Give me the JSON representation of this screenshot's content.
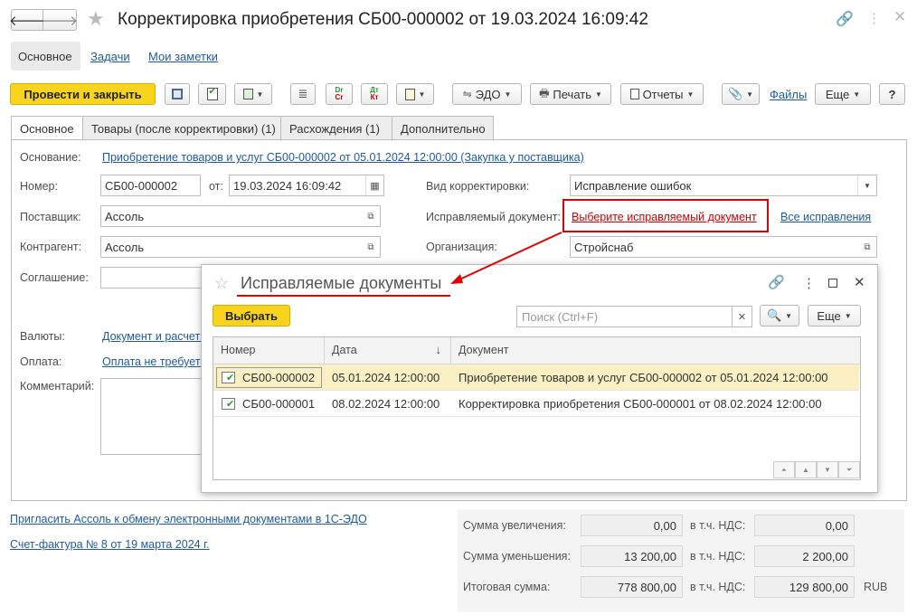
{
  "window": {
    "title": "Корректировка приобретения СБ00-000002 от 19.03.2024 16:09:42"
  },
  "nav": {
    "back": "🡐",
    "forward": "🡒"
  },
  "section_tabs": [
    "Основное",
    "Задачи",
    "Мои заметки"
  ],
  "toolbar": {
    "post_close": "Провести и закрыть",
    "edo": "ЭДО",
    "print": "Печать",
    "reports": "Отчеты",
    "files": "Файлы",
    "more": "Еще",
    "help": "?",
    "dt_top": "Dr",
    "dt_bottom": "Cr",
    "dt2_top": "Дт",
    "dt2_bottom": "Кт"
  },
  "form_tabs": [
    "Основное",
    "Товары (после корректировки) (1)",
    "Расхождения (1)",
    "Дополнительно"
  ],
  "form": {
    "basis_label": "Основание:",
    "basis_value": "Приобретение товаров и услуг СБ00-000002 от 05.01.2024 12:00:00 (Закупка у поставщика)",
    "number_label": "Номер:",
    "number_value": "СБ00-000002",
    "date_label": "от:",
    "date_value": "19.03.2024 16:09:42",
    "corr_type_label": "Вид корректировки:",
    "corr_type_value": "Исправление ошибок",
    "supplier_label": "Поставщик:",
    "supplier_value": "Ассоль",
    "fixed_doc_label": "Исправляемый документ:",
    "fixed_doc_value": "Выберите исправляемый документ",
    "all_fixes": "Все исправления",
    "counterparty_label": "Контрагент:",
    "counterparty_value": "Ассоль",
    "org_label": "Организация:",
    "org_value": "Стройснаб",
    "agreement_label": "Соглашение:",
    "currency_label": "Валюты:",
    "currency_value": "Документ и расчеты в RUB",
    "payment_label": "Оплата:",
    "payment_value": "Оплата не требуется",
    "comment_label": "Комментарий:"
  },
  "footer": {
    "invite": "Пригласить Ассоль к обмену электронными документами в 1С-ЭДО",
    "invoice": "Счет-фактура № 8 от 19 марта 2024 г.",
    "increase_label": "Сумма увеличения:",
    "increase_value": "0,00",
    "decrease_label": "Сумма уменьшения:",
    "decrease_value": "13 200,00",
    "total_label": "Итоговая сумма:",
    "total_value": "778 800,00",
    "vat_label": "в т.ч. НДС:",
    "vat_increase": "0,00",
    "vat_decrease": "2 200,00",
    "vat_total": "129 800,00",
    "currency": "RUB"
  },
  "dialog": {
    "title": "Исправляемые документы",
    "select_button": "Выбрать",
    "search_placeholder": "Поиск (Ctrl+F)",
    "more": "Еще",
    "columns": [
      "Номер",
      "Дата",
      "Документ"
    ],
    "sort_arrow": "↓",
    "rows": [
      {
        "number": "СБ00-000002",
        "date": "05.01.2024 12:00:00",
        "doc": "Приобретение товаров и услуг СБ00-000002 от 05.01.2024 12:00:00"
      },
      {
        "number": "СБ00-000001",
        "date": "08.02.2024 12:00:00",
        "doc": "Корректировка приобретения СБ00-000001 от 08.02.2024 12:00:00"
      }
    ]
  },
  "colors": {
    "accent_yellow": "#f8d41e",
    "highlight_red": "#e00000",
    "link": "#1f5aa6",
    "selected_row": "#fbf0c4"
  }
}
